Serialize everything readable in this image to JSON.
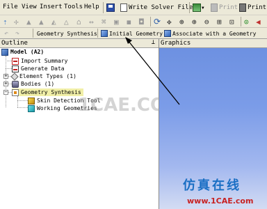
{
  "menu": [
    "File",
    "View",
    "Insert",
    "Tools",
    "Help"
  ],
  "toolbar1": {
    "write_solver_file": "Write Solver File",
    "print1": "Print",
    "print2": "Print"
  },
  "toolbar2": {
    "geometry_synthesis": "Geometry Synthesis",
    "initial_geometry": "Initial Geometry",
    "associate": "Associate with a Geometry"
  },
  "outline": {
    "title": "Outline",
    "pin": "ᵖ"
  },
  "graphics": {
    "title": "Graphics"
  },
  "tree": {
    "root": "Model (A2)",
    "import_summary": "Import Summary",
    "generate_data": "Generate Data",
    "element_types": "Element Types (1)",
    "bodies": "Bodies (1)",
    "geometry_synthesis": "Geometry Synthesis",
    "skin_detection_tool": "Skin Detection Tool",
    "working_geometries": "Working Geometries"
  },
  "watermark": {
    "center": "1CAE.COM",
    "brand_cn": "仿真在线",
    "brand_url": "www.1CAE.com"
  },
  "colors": {
    "accent_red": "#cc2222",
    "graphics_top": "#6b8fe0",
    "brand_blue": "#1b6fc4"
  }
}
